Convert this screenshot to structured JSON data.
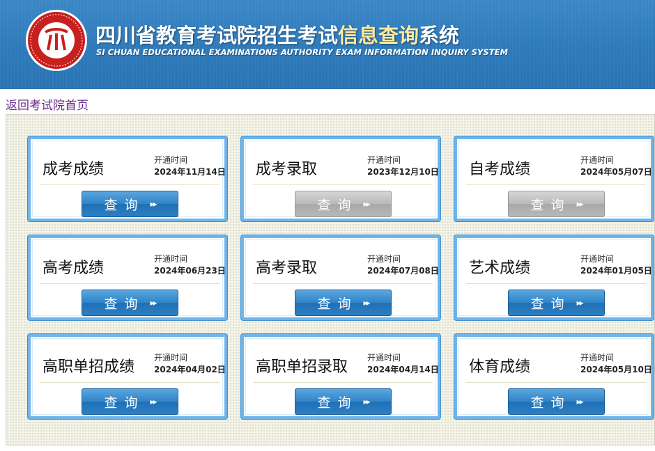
{
  "header": {
    "title_main": "四川省教育考试院招生考试",
    "title_highlight": "信息查询",
    "title_tail": "系统",
    "subtitle": "SI CHUAN EDUCATIONAL EXAMINATIONS AUTHORITY EXAM INFORMATION INQUIRY SYSTEM",
    "logo_icon": "sceea-seal-logo"
  },
  "nav": {
    "back_link": "返回考试院首页"
  },
  "colors": {
    "header_blue": "#2d79ba",
    "card_border": "#6fb5ea",
    "button_active": "#2f84c8",
    "button_disabled": "#b9b9b9",
    "link_purple": "#6a2b8f",
    "title_highlight": "#ffe9a0"
  },
  "cards": [
    {
      "name": "成考成绩",
      "open_label": "开通时间",
      "open_date": "2024年11月14日",
      "button_label": "查询",
      "button_icon": "double-chevron-right-icon",
      "enabled": true
    },
    {
      "name": "成考录取",
      "open_label": "开通时间",
      "open_date": "2023年12月10日",
      "button_label": "查询",
      "button_icon": "double-chevron-right-icon",
      "enabled": false
    },
    {
      "name": "自考成绩",
      "open_label": "开通时间",
      "open_date": "2024年05月07日",
      "button_label": "查询",
      "button_icon": "double-chevron-right-icon",
      "enabled": false
    },
    {
      "name": "高考成绩",
      "open_label": "开通时间",
      "open_date": "2024年06月23日",
      "button_label": "查询",
      "button_icon": "double-chevron-right-icon",
      "enabled": true
    },
    {
      "name": "高考录取",
      "open_label": "开通时间",
      "open_date": "2024年07月08日",
      "button_label": "查询",
      "button_icon": "double-chevron-right-icon",
      "enabled": true
    },
    {
      "name": "艺术成绩",
      "open_label": "开通时间",
      "open_date": "2024年01月05日",
      "button_label": "查询",
      "button_icon": "double-chevron-right-icon",
      "enabled": true
    },
    {
      "name": "高职单招成绩",
      "open_label": "开通时间",
      "open_date": "2024年04月02日",
      "button_label": "查询",
      "button_icon": "double-chevron-right-icon",
      "enabled": true
    },
    {
      "name": "高职单招录取",
      "open_label": "开通时间",
      "open_date": "2024年04月14日",
      "button_label": "查询",
      "button_icon": "double-chevron-right-icon",
      "enabled": true
    },
    {
      "name": "体育成绩",
      "open_label": "开通时间",
      "open_date": "2024年05月10日",
      "button_label": "查询",
      "button_icon": "double-chevron-right-icon",
      "enabled": true
    }
  ]
}
